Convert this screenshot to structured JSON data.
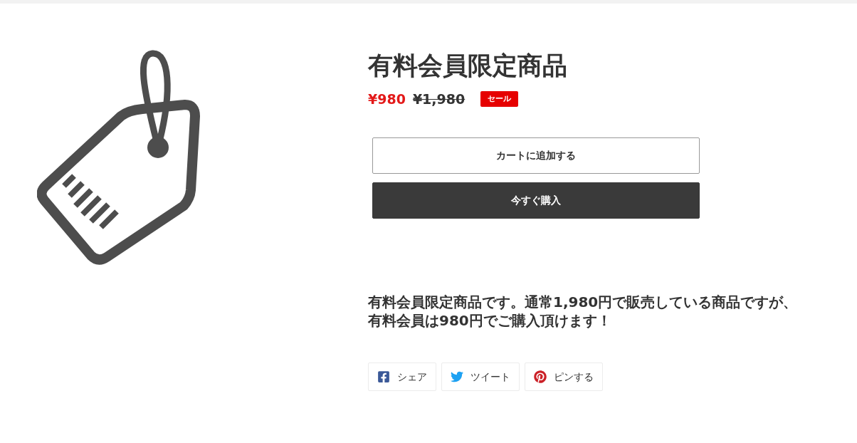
{
  "product": {
    "title": "有料会員限定商品",
    "sale_price": "¥980",
    "regular_price": "¥1,980",
    "badge": "セール"
  },
  "buttons": [
    {
      "label": "カートに追加する",
      "kind": "secondary"
    },
    {
      "label": "今すぐ購入",
      "kind": "primary"
    }
  ],
  "description": "有料会員限定商品です。通常1,980円で販売している商品ですが、有料会員は980円でご購入頂けます！",
  "share": [
    {
      "label": "シェア",
      "kind": "facebook"
    },
    {
      "label": "ツイート",
      "kind": "twitter"
    },
    {
      "label": "ピンする",
      "kind": "pinterest"
    }
  ]
}
